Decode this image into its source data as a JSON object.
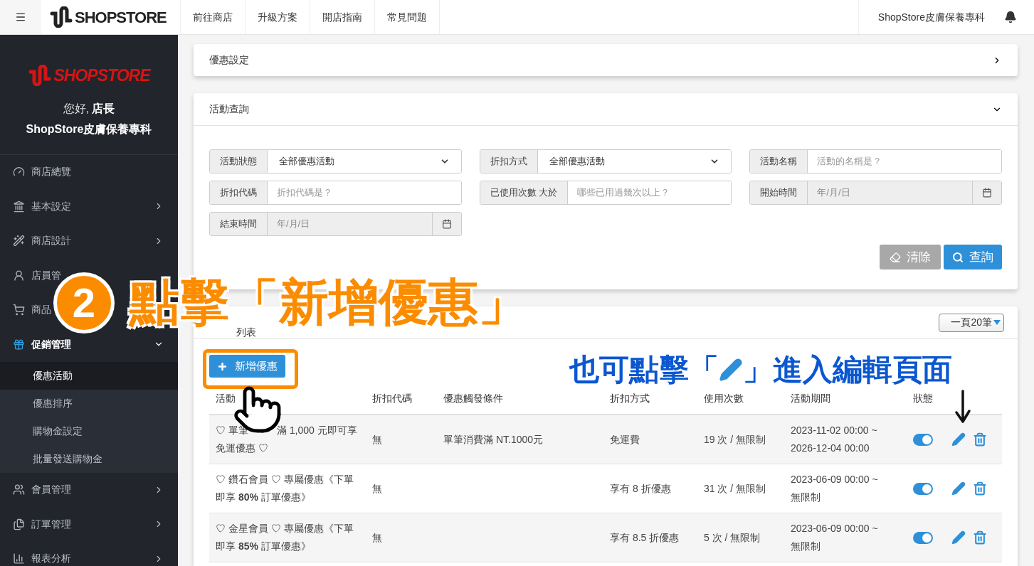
{
  "topbar": {
    "logo": "SHOPSTORE",
    "nav": [
      "前往商店",
      "升級方案",
      "開店指南",
      "常見問題"
    ],
    "store_name": "ShopStore皮膚保養專科"
  },
  "sidebar": {
    "logo": "SHOPSTORE",
    "greeting": "您好,",
    "role": "店長",
    "store_name": "ShopStore皮膚保養專科",
    "items": [
      {
        "label": "商店總覽",
        "collapsible": false,
        "expanded": false
      },
      {
        "label": "基本設定",
        "collapsible": true,
        "expanded": false
      },
      {
        "label": "商店設計",
        "collapsible": true,
        "expanded": false
      },
      {
        "label": "店員管",
        "collapsible": false,
        "expanded": false
      },
      {
        "label": "商品",
        "collapsible": false,
        "expanded": false
      },
      {
        "label": "促銷管理",
        "collapsible": true,
        "expanded": true,
        "children": [
          {
            "label": "優惠活動",
            "selected": true
          },
          {
            "label": "優惠排序",
            "selected": false
          },
          {
            "label": "購物金設定",
            "selected": false
          },
          {
            "label": "批量發送購物金",
            "selected": false
          }
        ]
      },
      {
        "label": "會員管理",
        "collapsible": true,
        "expanded": false
      },
      {
        "label": "訂單管理",
        "collapsible": true,
        "expanded": false
      },
      {
        "label": "報表分析",
        "collapsible": true,
        "expanded": false
      }
    ]
  },
  "settings_panel": {
    "title": "優惠設定",
    "expanded": false
  },
  "search_panel": {
    "title": "活動查詢",
    "expanded": true,
    "filters": [
      {
        "kind": "select",
        "label": "活動狀態",
        "value": "全部優惠活動"
      },
      {
        "kind": "select",
        "label": "折扣方式",
        "value": "全部優惠活動"
      },
      {
        "kind": "text",
        "label": "活動名稱",
        "placeholder": "活動的名稱是？"
      },
      {
        "kind": "text",
        "label": "折扣代碼",
        "placeholder": "折扣代碼是？"
      },
      {
        "kind": "text",
        "label": "已使用次數 大於",
        "placeholder": "哪些已用過幾次以上？"
      },
      {
        "kind": "date",
        "label": "開始時間",
        "placeholder": "年/月/日"
      },
      {
        "kind": "date",
        "label": "結束時間",
        "placeholder": "年/月/日"
      }
    ],
    "clear_button": {
      "label": "清除",
      "disabled": true
    },
    "search_button": "查詢"
  },
  "list_panel": {
    "title": "列表",
    "page_size": "一頁20筆",
    "add_button": "新增優惠",
    "columns": [
      "活動",
      "折扣代碼",
      "優惠觸發條件",
      "折扣方式",
      "使用次數",
      "活動期間",
      "狀態"
    ],
    "rows": [
      {
        "name_parts": [
          "♡ 單筆",
          "滿 1,000 元即可享",
          "免運優惠 ♡"
        ],
        "code": "無",
        "condition": "單筆消費滿 NT.1000元",
        "method": "免運費",
        "usage": "19 次 / 無限制",
        "period": "2023-11-02 00:00 ~ 2026-12-04 00:00",
        "on": true
      },
      {
        "name_parts": [
          "♡ 鑽石會員 ♡ 專屬優惠《下單即享 **80%** 訂單優惠》"
        ],
        "code": "無",
        "method": "享有 8 折優惠",
        "usage": "31 次 / 無限制",
        "period": "2023-06-09 00:00 ~ 無限制",
        "on": true
      },
      {
        "name_parts": [
          "♡ 金星會員 ♡ 專屬優惠《下單即享 **85%** 訂單優惠》"
        ],
        "code": "無",
        "method": "享有 8.5 折優惠",
        "usage": "5 次 / 無限制",
        "period": "2023-06-09 00:00 ~ 無限制",
        "on": true
      }
    ]
  },
  "annotations": {
    "step": "2",
    "step_text": "點擊「新增優惠」",
    "hint_before": "也可點擊「",
    "hint_after": "」進入編輯頁面"
  }
}
